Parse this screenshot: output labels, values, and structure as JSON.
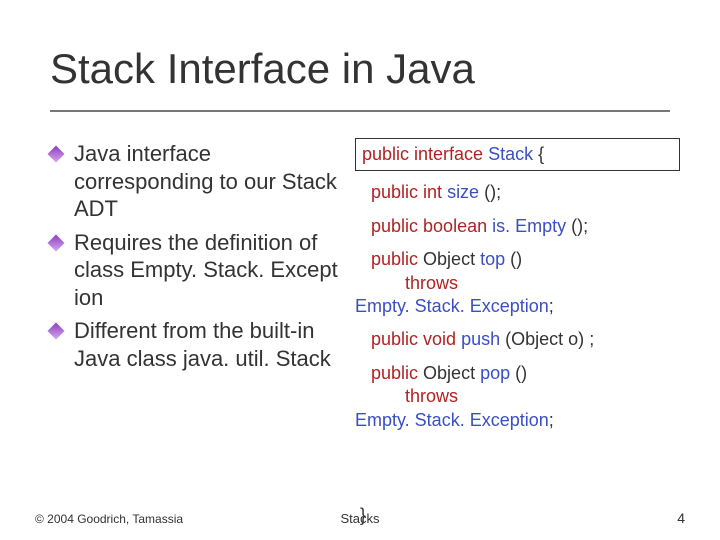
{
  "title": "Stack Interface in Java",
  "bullets": [
    {
      "text_parts": [
        "Java interface corresponding to our Stack ADT"
      ]
    },
    {
      "text_before": "Requires the definition of class ",
      "code": "Empty. Stack. Except ion"
    },
    {
      "text_before": "Different from the built-in Java class ",
      "code": "java. util. Stack"
    }
  ],
  "code": {
    "line1": {
      "kw": "public interface",
      "name": "Stack",
      "tail": " {"
    },
    "size": {
      "kw": "public int",
      "name": "size",
      "tail": "();"
    },
    "isEmpty": {
      "kw": "public boolean",
      "name": "is. Empty",
      "tail": "();"
    },
    "top_l1": {
      "kw": "public",
      "ret": "Object",
      "name": "top",
      "tail": "()"
    },
    "throws": "throws",
    "exc": "Empty. Stack. Exception",
    "push": {
      "kw": "public void",
      "name": "push",
      "args": "(Object o)",
      "tail": ";"
    },
    "pop_l1": {
      "kw": "public",
      "ret": "Object",
      "name": "pop",
      "tail": "()"
    },
    "semicolon": ";",
    "close": "}"
  },
  "footer": {
    "left": "© 2004 Goodrich, Tamassia",
    "mid": "Stacks",
    "right": "4"
  }
}
